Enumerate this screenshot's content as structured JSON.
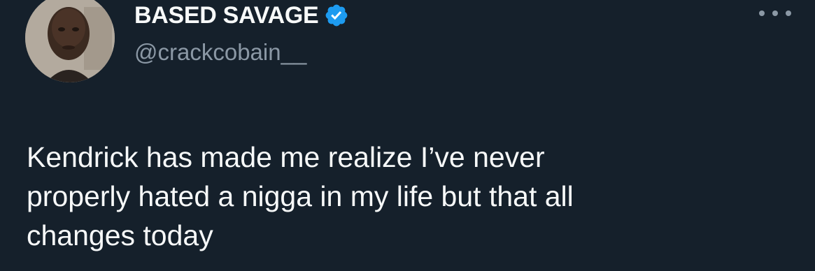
{
  "author": {
    "display_name": "BASED SAVAGE",
    "handle": "@crackcobain__",
    "verified": true
  },
  "tweet": {
    "text": "Kendrick has made me realize I’ve never\nproperly hated a nigga in my life but that all\nchanges today"
  },
  "icons": {
    "verified": "verified-badge-icon",
    "more": "more-options-icon"
  },
  "colors": {
    "background": "#15202b",
    "text_primary": "#f7f9f9",
    "text_secondary": "#8b98a5",
    "verified_blue": "#1d9bf0"
  }
}
